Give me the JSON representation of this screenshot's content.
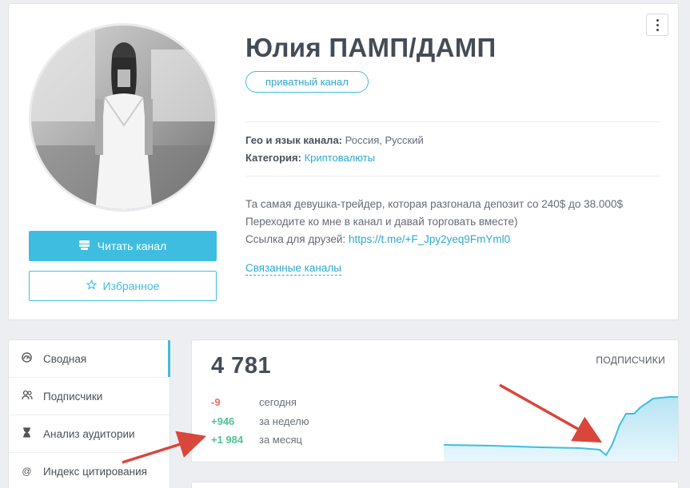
{
  "channel": {
    "title": "Юлия ПАМП/ДАМП",
    "badge": "приватный канал",
    "geo_label": "Гео и язык канала:",
    "geo_value": "Россия, Русский",
    "category_label": "Категория:",
    "category_value": "Криптовалюты",
    "description": [
      "Та самая девушка-трейдер, которая разгонала депозит со 240$ до 38.000$",
      "Переходите ко мне в канал и давай торговать вместе)"
    ],
    "link_prefix": "Ссылка для друзей: ",
    "link_text": "https://t.me/+F_Jpy2yeq9FmYml0",
    "related_label": "Связанные каналы"
  },
  "actions": {
    "read_label": "Читать канал",
    "favorite_label": "Избранное"
  },
  "sidebar": {
    "items": [
      {
        "label": "Сводная",
        "icon": "dashboard-icon",
        "active": true
      },
      {
        "label": "Подписчики",
        "icon": "users-icon",
        "active": false
      },
      {
        "label": "Анализ аудитории",
        "icon": "hourglass-icon",
        "active": false
      },
      {
        "label": "Индекс цитирования",
        "icon": "at-icon",
        "active": false
      }
    ]
  },
  "stats": {
    "total": "4 781",
    "label": "ПОДПИСЧИКИ",
    "deltas": [
      {
        "value": "-9",
        "period": "сегодня",
        "sign": "neg"
      },
      {
        "value": "+946",
        "period": "за неделю",
        "sign": "pos"
      },
      {
        "value": "+1 984",
        "period": "за месяц",
        "sign": "pos"
      }
    ]
  },
  "colors": {
    "accent": "#3fbde0",
    "positive": "#4ec296",
    "negative": "#e86d6d",
    "annotation_arrow": "#d9463b"
  }
}
